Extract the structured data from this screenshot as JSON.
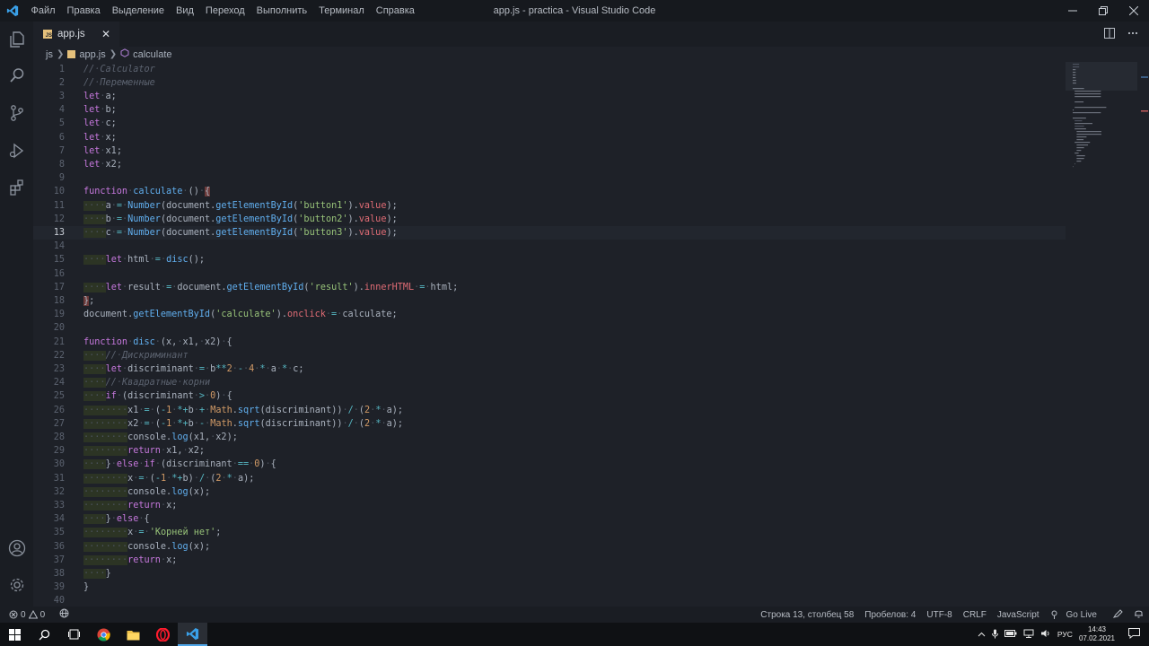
{
  "window": {
    "title": "app.js - practica - Visual Studio Code",
    "menu": [
      "Файл",
      "Правка",
      "Выделение",
      "Вид",
      "Переход",
      "Выполнить",
      "Терминал",
      "Справка"
    ]
  },
  "tabs": [
    {
      "label": "app.js",
      "close": "✕"
    }
  ],
  "breadcrumb": {
    "folder": "js",
    "file": "app.js",
    "symbol": "calculate"
  },
  "editor": {
    "current_line": 13,
    "lines": [
      "// Calculator",
      "// Переменные",
      "let a;",
      "let b;",
      "let c;",
      "let x;",
      "let x1;",
      "let x2;",
      "",
      "function calculate () {",
      "    a = Number(document.getElementById('button1').value);",
      "    b = Number(document.getElementById('button2').value);",
      "    c = Number(document.getElementById('button3').value);",
      "",
      "    let html = disc();",
      "",
      "    let result = document.getElementById('result').innerHTML = html;",
      "};",
      "document.getElementById('calculate').onclick = calculate;",
      "",
      "function disc (x, x1, x2) {",
      "    // Дискриминант",
      "    let discriminant = b**2 - 4 * a * c;",
      "    // Квадратные корни",
      "    if (discriminant > 0) {",
      "        x1 = (-1 *+b + Math.sqrt(discriminant)) / (2 * a);",
      "        x2 = (-1 *+b - Math.sqrt(discriminant)) / (2 * a);",
      "        console.log(x1, x2);",
      "        return x1, x2;",
      "    } else if (discriminant == 0) {",
      "        x = (-1 *+b) / (2 * a);",
      "        console.log(x);",
      "        return x;",
      "    } else {",
      "        x = 'Корней нет';",
      "        console.log(x);",
      "        return x;",
      "    }",
      "}",
      ""
    ]
  },
  "statusbar": {
    "errors": "0",
    "warnings": "0",
    "position": "Строка 13, столбец 58",
    "spaces": "Пробелов: 4",
    "encoding": "UTF-8",
    "eol": "CRLF",
    "language": "JavaScript",
    "golive": "Go Live"
  },
  "taskbar": {
    "lang": "РУС",
    "time": "14:43",
    "date": "07.02.2021"
  },
  "colors": {
    "accent": "#4fa6e8",
    "keyword": "#c678dd",
    "function": "#61afef",
    "string": "#98c379",
    "number": "#d19a66",
    "comment": "#5c6370"
  }
}
